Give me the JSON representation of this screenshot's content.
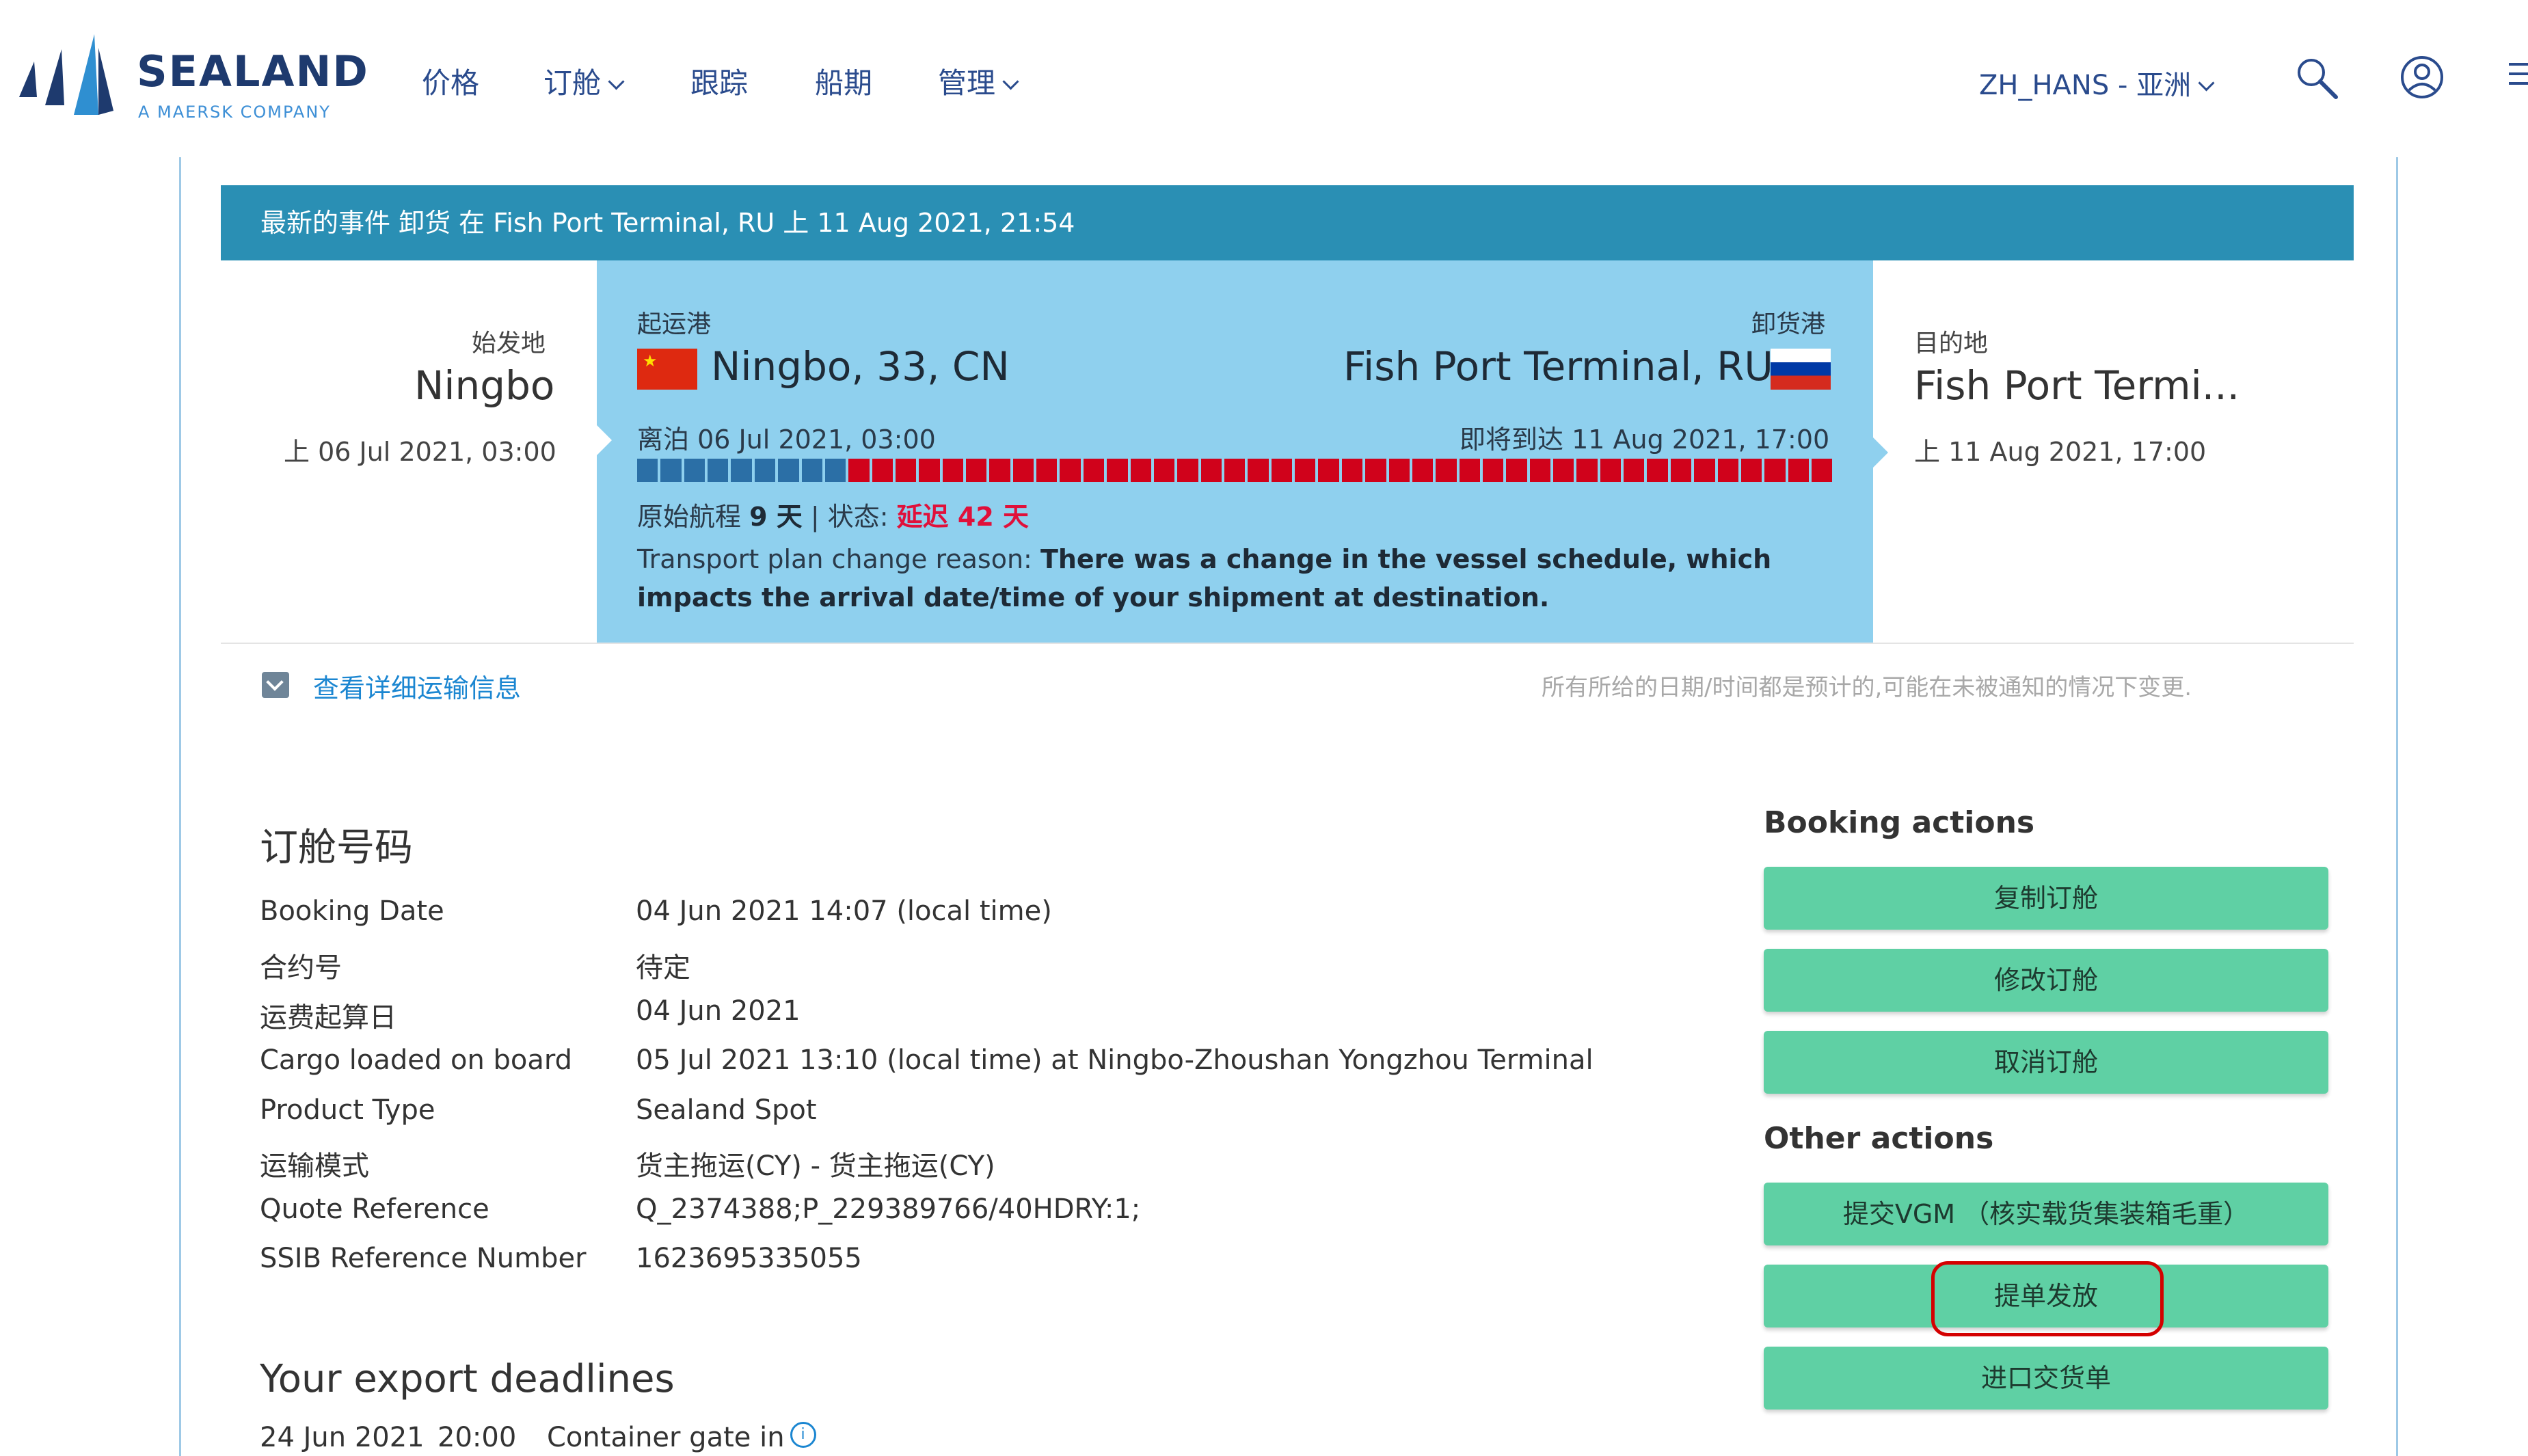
{
  "header": {
    "logo_text": "SEALAND",
    "logo_sub": "A MAERSK COMPANY",
    "nav": [
      {
        "label": "价格"
      },
      {
        "label": "订舱"
      },
      {
        "label": "跟踪"
      },
      {
        "label": "船期"
      },
      {
        "label": "管理"
      }
    ],
    "language": "ZH_HANS - 亚洲"
  },
  "event_bar": "最新的事件 卸货 在 Fish Port Terminal, RU 上 11 Aug 2021, 21:54",
  "origin": {
    "label": "始发地",
    "city": "Ningbo",
    "time": "上 06 Jul 2021, 03:00"
  },
  "voyage": {
    "pol_label": "起运港",
    "pol_city": "Ningbo, 33, CN",
    "pod_label": "卸货港",
    "pod_city": "Fish Port Terminal, RU",
    "departure": "离泊 06 Jul 2021, 03:00",
    "arrival": "即将到达 11 Aug 2021, 17:00",
    "progress": {
      "completed_segments": 9,
      "total_segments": 51
    },
    "status_prefix": "原始航程",
    "status_duration": "9 天",
    "status_mid": "| 状态:",
    "status_delay": "延迟 42 天",
    "reason_prefix": "Transport plan change reason:",
    "reason_text": "There was a change in the vessel schedule, which impacts the arrival date/time of your shipment at destination."
  },
  "destination": {
    "label": "目的地",
    "city": "Fish Port Termi...",
    "time": "上 11 Aug 2021, 17:00"
  },
  "details_link": "查看详细运输信息",
  "disclaimer": "所有所给的日期/时间都是预计的,可能在未被通知的情况下变更.",
  "booking": {
    "title": "订舱号码",
    "rows": [
      {
        "key": "Booking Date",
        "value": "04 Jun 2021 14:07 (local time)"
      },
      {
        "key": "合约号",
        "value": "待定"
      },
      {
        "key": "运费起算日",
        "value": "04 Jun 2021"
      },
      {
        "key": "Cargo loaded on board",
        "value": "05 Jul 2021 13:10 (local time) at Ningbo-Zhoushan Yongzhou Terminal"
      },
      {
        "key": "Product Type",
        "value": "Sealand Spot"
      },
      {
        "key": "运输模式",
        "value": "货主拖运(CY) - 货主拖运(CY)"
      },
      {
        "key": "Quote Reference",
        "value": "Q_2374388;P_229389766/40HDRY:1;"
      },
      {
        "key": "SSIB Reference Number",
        "value": "1623695335055"
      }
    ]
  },
  "deadlines": {
    "title": "Your export deadlines",
    "date": "24 Jun 2021",
    "time": "20:00",
    "label": "Container gate in",
    "info_icon": "i"
  },
  "actions": {
    "booking_title": "Booking actions",
    "booking_buttons": [
      "复制订舱",
      "修改订舱",
      "取消订舱"
    ],
    "other_title": "Other actions",
    "other_buttons": [
      "提交VGM （核实载货集装箱毛重）",
      "提单发放",
      "进口交货单"
    ]
  },
  "colors": {
    "event_bar": "#2a8fb4",
    "voyage_panel": "#8fd0ee",
    "progress_done": "#2b6fa6",
    "progress_delay": "#d0021b",
    "action_button": "#5fd0a4",
    "highlight_ring": "#d40000",
    "link": "#1b86d1"
  }
}
